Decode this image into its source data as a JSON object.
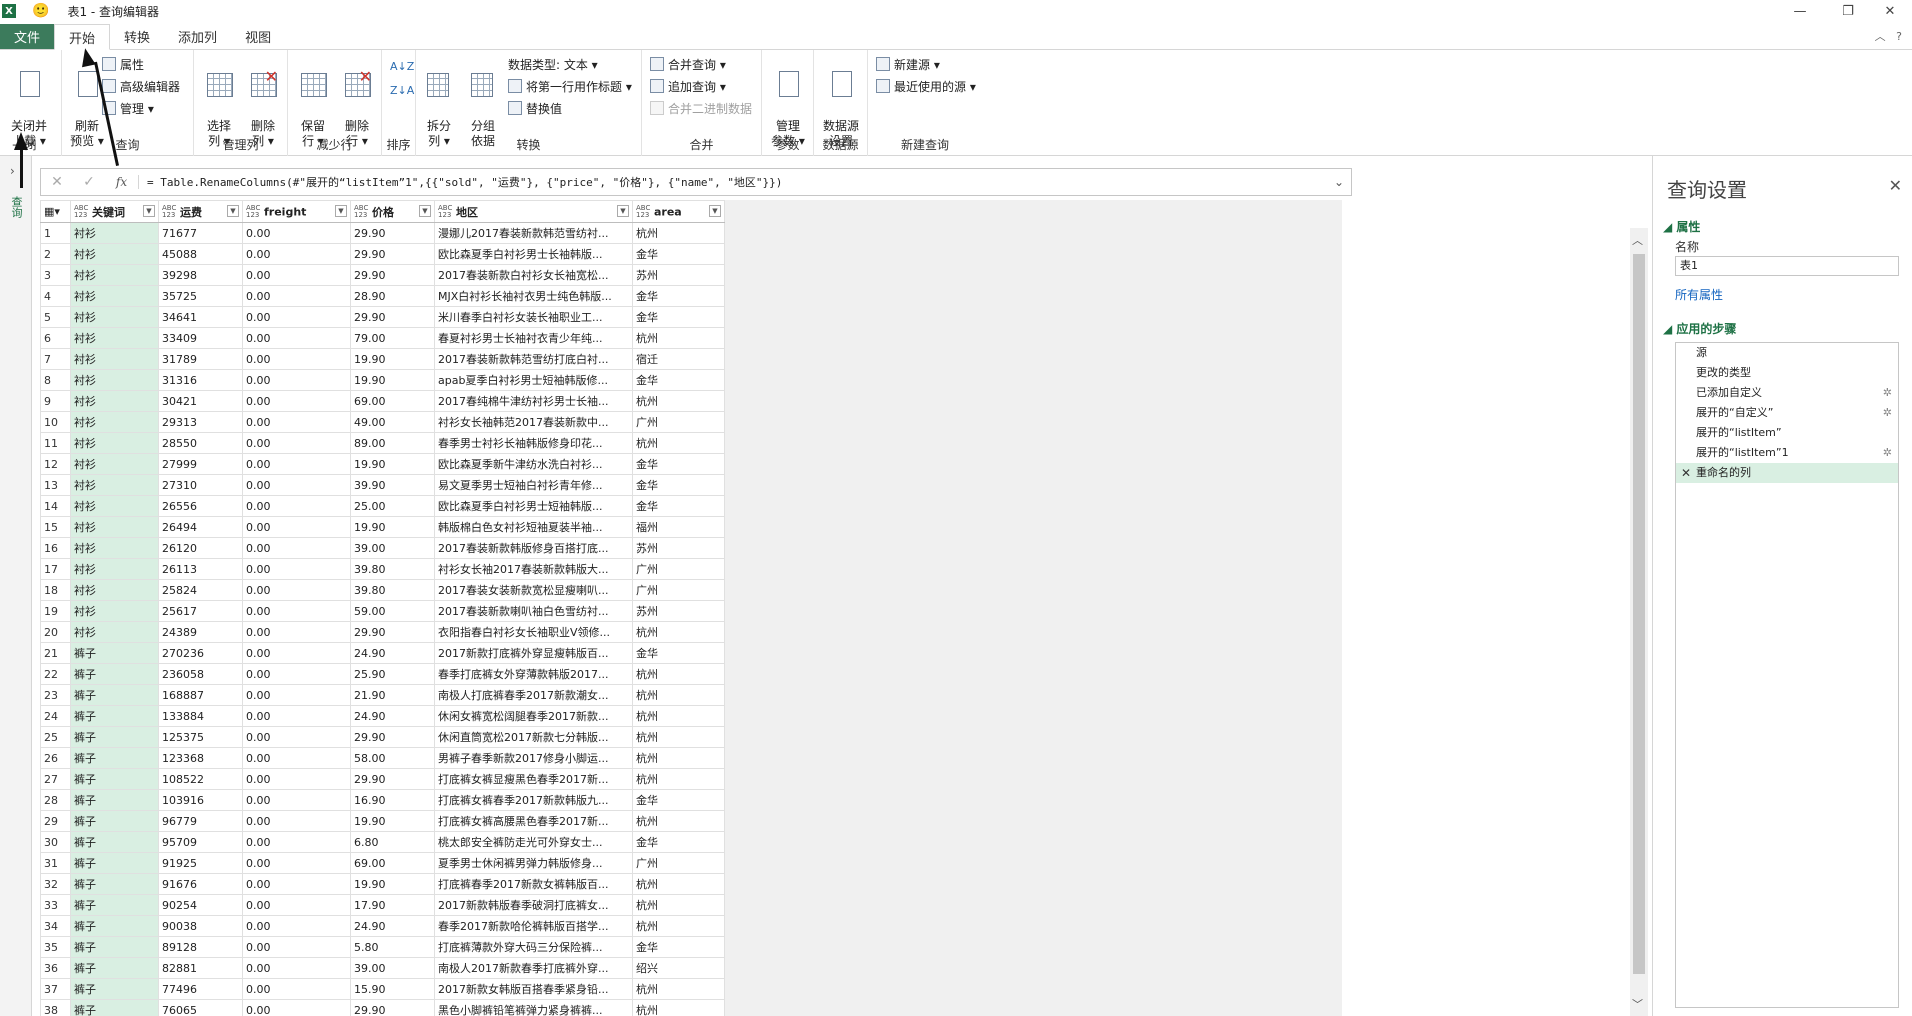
{
  "titlebar": {
    "title": "表1 - 查询编辑器",
    "app_icon": "X",
    "smiley": "🙂"
  },
  "tabs": {
    "file": "文件",
    "home": "开始",
    "transform": "转换",
    "add_column": "添加列",
    "view": "视图"
  },
  "ribbon": {
    "close_load": "关闭并\n上载 ▾",
    "refresh_preview": "刷新\n预览 ▾",
    "properties": "属性",
    "advanced_editor": "高级编辑器",
    "manage": "管理 ▾",
    "choose_columns": "选择\n列 ▾",
    "remove_columns": "删除\n列 ▾",
    "keep_rows": "保留\n行 ▾",
    "remove_rows": "删除\n行 ▾",
    "split_column": "拆分\n列 ▾",
    "group_by": "分组\n依据",
    "data_type": "数据类型: 文本 ▾",
    "use_first_row": "将第一行用作标题 ▾",
    "replace_values": "替换值",
    "merge_queries": "合并查询 ▾",
    "append_queries": "追加查询 ▾",
    "combine_binaries": "合并二进制数据",
    "manage_params": "管理\n参数 ▾",
    "data_source_settings": "数据源\n设置",
    "new_source": "新建源 ▾",
    "recent_sources": "最近使用的源 ▾",
    "groups": {
      "close": "闭",
      "query": "查询",
      "manage_columns": "管理列",
      "reduce_rows": "减少行",
      "sort": "排序",
      "transform": "转换",
      "combine": "合并",
      "params": "参数",
      "data_source": "数据源",
      "new_query": "新建查询"
    }
  },
  "formula": {
    "text": "= Table.RenameColumns(#\"展开的“listItem”1\",{{\"sold\", \"运费\"}, {\"price\", \"价格\"}, {\"name\", \"地区\"}})"
  },
  "leftnav": {
    "label": "查询"
  },
  "table": {
    "columns": [
      {
        "type": "ABC\n123",
        "name": "关键词"
      },
      {
        "type": "ABC\n123",
        "name": "运费"
      },
      {
        "type": "ABC\n123",
        "name": "freight"
      },
      {
        "type": "ABC\n123",
        "name": "价格"
      },
      {
        "type": "ABC\n123",
        "name": "地区"
      },
      {
        "type": "ABC\n123",
        "name": "area"
      }
    ],
    "rows": [
      [
        "1",
        "衬衫",
        "71677",
        "0.00",
        "29.90",
        "漫娜儿2017春装新款韩范雪纺衬...",
        "杭州"
      ],
      [
        "2",
        "衬衫",
        "45088",
        "0.00",
        "29.90",
        "欧比森夏季白衬衫男士长袖韩版...",
        "金华"
      ],
      [
        "3",
        "衬衫",
        "39298",
        "0.00",
        "29.90",
        "2017春装新款白衬衫女长袖宽松...",
        "苏州"
      ],
      [
        "4",
        "衬衫",
        "35725",
        "0.00",
        "28.90",
        "MJX白衬衫长袖衬衣男士纯色韩版...",
        "金华"
      ],
      [
        "5",
        "衬衫",
        "34641",
        "0.00",
        "29.90",
        "米川春季白衬衫女装长袖职业工...",
        "金华"
      ],
      [
        "6",
        "衬衫",
        "33409",
        "0.00",
        "79.00",
        "春夏衬衫男士长袖衬衣青少年纯...",
        "杭州"
      ],
      [
        "7",
        "衬衫",
        "31789",
        "0.00",
        "19.90",
        "2017春装新款韩范雪纺打底白衬...",
        "宿迁"
      ],
      [
        "8",
        "衬衫",
        "31316",
        "0.00",
        "19.90",
        "apab夏季白衬衫男士短袖韩版修...",
        "金华"
      ],
      [
        "9",
        "衬衫",
        "30421",
        "0.00",
        "69.00",
        "2017春纯棉牛津纺衬衫男士长袖...",
        "杭州"
      ],
      [
        "10",
        "衬衫",
        "29313",
        "0.00",
        "49.00",
        "衬衫女长袖韩范2017春装新款中...",
        "广州"
      ],
      [
        "11",
        "衬衫",
        "28550",
        "0.00",
        "89.00",
        "春季男士衬衫长袖韩版修身印花...",
        "杭州"
      ],
      [
        "12",
        "衬衫",
        "27999",
        "0.00",
        "19.90",
        "欧比森夏季新牛津纺水洗白衬衫...",
        "金华"
      ],
      [
        "13",
        "衬衫",
        "27310",
        "0.00",
        "39.90",
        "易文夏季男士短袖白衬衫青年修...",
        "金华"
      ],
      [
        "14",
        "衬衫",
        "26556",
        "0.00",
        "25.00",
        "欧比森夏季白衬衫男士短袖韩版...",
        "金华"
      ],
      [
        "15",
        "衬衫",
        "26494",
        "0.00",
        "19.90",
        "韩版棉白色女衬衫短袖夏装半袖...",
        "福州"
      ],
      [
        "16",
        "衬衫",
        "26120",
        "0.00",
        "39.00",
        "2017春装新款韩版修身百搭打底...",
        "苏州"
      ],
      [
        "17",
        "衬衫",
        "26113",
        "0.00",
        "39.80",
        "衬衫女长袖2017春装新款韩版大...",
        "广州"
      ],
      [
        "18",
        "衬衫",
        "25824",
        "0.00",
        "39.80",
        "2017春装女装新款宽松显瘦喇叭...",
        "广州"
      ],
      [
        "19",
        "衬衫",
        "25617",
        "0.00",
        "59.00",
        "2017春装新款喇叭袖白色雪纺衬...",
        "苏州"
      ],
      [
        "20",
        "衬衫",
        "24389",
        "0.00",
        "29.90",
        "衣阳指春白衬衫女长袖职业V领修...",
        "杭州"
      ],
      [
        "21",
        "裤子",
        "270236",
        "0.00",
        "24.90",
        "2017新款打底裤外穿显瘦韩版百...",
        "金华"
      ],
      [
        "22",
        "裤子",
        "236058",
        "0.00",
        "25.90",
        "春季打底裤女外穿薄款韩版2017...",
        "杭州"
      ],
      [
        "23",
        "裤子",
        "168887",
        "0.00",
        "21.90",
        "南极人打底裤春季2017新款潮女...",
        "杭州"
      ],
      [
        "24",
        "裤子",
        "133884",
        "0.00",
        "24.90",
        "休闲女裤宽松阔腿春季2017新款...",
        "杭州"
      ],
      [
        "25",
        "裤子",
        "125375",
        "0.00",
        "29.90",
        "休闲直筒宽松2017新款七分韩版...",
        "杭州"
      ],
      [
        "26",
        "裤子",
        "123368",
        "0.00",
        "58.00",
        "男裤子春季新款2017修身小脚运...",
        "杭州"
      ],
      [
        "27",
        "裤子",
        "108522",
        "0.00",
        "29.90",
        "打底裤女裤显瘦黑色春季2017新...",
        "杭州"
      ],
      [
        "28",
        "裤子",
        "103916",
        "0.00",
        "16.90",
        "打底裤女裤春季2017新款韩版九...",
        "金华"
      ],
      [
        "29",
        "裤子",
        "96779",
        "0.00",
        "19.90",
        "打底裤女裤高腰黑色春季2017新...",
        "杭州"
      ],
      [
        "30",
        "裤子",
        "95709",
        "0.00",
        "6.80",
        "桃太郎安全裤防走光可外穿女士...",
        "金华"
      ],
      [
        "31",
        "裤子",
        "91925",
        "0.00",
        "69.00",
        "夏季男士休闲裤男弹力韩版修身...",
        "广州"
      ],
      [
        "32",
        "裤子",
        "91676",
        "0.00",
        "19.90",
        "打底裤春季2017新款女裤韩版百...",
        "杭州"
      ],
      [
        "33",
        "裤子",
        "90254",
        "0.00",
        "17.90",
        "2017新款韩版春季破洞打底裤女...",
        "杭州"
      ],
      [
        "34",
        "裤子",
        "90038",
        "0.00",
        "24.90",
        "春季2017新款哈伦裤韩版百搭学...",
        "杭州"
      ],
      [
        "35",
        "裤子",
        "89128",
        "0.00",
        "5.80",
        "打底裤薄款外穿大码三分保险裤...",
        "金华"
      ],
      [
        "36",
        "裤子",
        "82881",
        "0.00",
        "39.00",
        "南极人2017新款春季打底裤外穿...",
        "绍兴"
      ],
      [
        "37",
        "裤子",
        "77496",
        "0.00",
        "15.90",
        "2017新款女韩版百搭春季紧身铅...",
        "杭州"
      ],
      [
        "38",
        "裤子",
        "76065",
        "0.00",
        "29.90",
        "黑色小脚裤铅笔裤弹力紧身裤裤...",
        "杭州"
      ]
    ]
  },
  "query_settings": {
    "title": "查询设置",
    "properties": "属性",
    "name_label": "名称",
    "name_value": "表1",
    "all_properties": "所有属性",
    "applied_steps": "应用的步骤",
    "steps": [
      {
        "label": "源",
        "gear": ""
      },
      {
        "label": "更改的类型",
        "gear": ""
      },
      {
        "label": "已添加自定义",
        "gear": "✲"
      },
      {
        "label": "展开的“自定义”",
        "gear": "✲"
      },
      {
        "label": "展开的“listItem”",
        "gear": ""
      },
      {
        "label": "展开的“listItem”1",
        "gear": "✲"
      },
      {
        "label": "重命名的列",
        "gear": "",
        "selected": true
      }
    ]
  }
}
